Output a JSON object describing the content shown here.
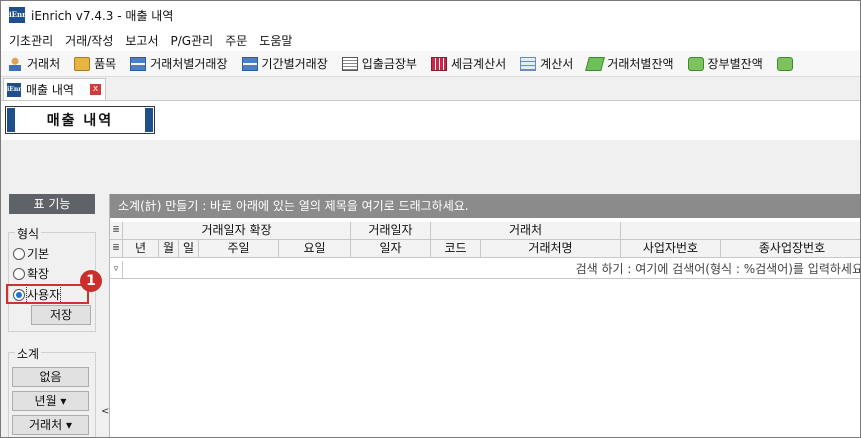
{
  "window": {
    "title": "iEnrich v7.4.3 - 매출 내역",
    "logo_text": "iEnr"
  },
  "menu": [
    "기초관리",
    "거래/작성",
    "보고서",
    "P/G관리",
    "주문",
    "도움말"
  ],
  "toolbar": [
    {
      "label": "거래처",
      "icon": "person-icon"
    },
    {
      "label": "품목",
      "icon": "box-icon"
    },
    {
      "label": "거래처별거래장",
      "icon": "ledger-icon"
    },
    {
      "label": "기간별거래장",
      "icon": "ledger-icon"
    },
    {
      "label": "입출금장부",
      "icon": "document-icon"
    },
    {
      "label": "세금계산서",
      "icon": "tax-invoice-icon"
    },
    {
      "label": "계산서",
      "icon": "invoice-icon"
    },
    {
      "label": "거래처별잔액",
      "icon": "money-icon"
    },
    {
      "label": "장부별잔액",
      "icon": "money-icon"
    }
  ],
  "tab": {
    "label": "매출 내역",
    "close": "x"
  },
  "page_title": "매출 내역",
  "left_panel": {
    "header": "표 기능",
    "format_group": {
      "title": "형식",
      "options": [
        "기본",
        "확장",
        "사용자"
      ],
      "selected": "사용자",
      "save_label": "저장"
    },
    "step_badge": "1",
    "subtotal_group": {
      "title": "소계",
      "buttons": [
        "없음",
        "년월 ▾",
        "거래처 ▾"
      ]
    },
    "collapse": "<"
  },
  "grid": {
    "group_bar_text": "소계(計) 만들기 : 바로 아래에 있는 열의 제목을 여기로 드래그하세요.",
    "header_groups": [
      "거래일자 확장",
      "거래일자",
      "거래처"
    ],
    "columns": [
      "년",
      "월",
      "일",
      "주일",
      "요일",
      "일자",
      "코드",
      "거래처명",
      "사업자번호",
      "종사업장번호"
    ],
    "filter_hint": "검색 하기 : 여기에 검색어(형식 : %검색어)를 입력하세요",
    "row_indicator": "≣",
    "filter_indicator": "▿"
  }
}
